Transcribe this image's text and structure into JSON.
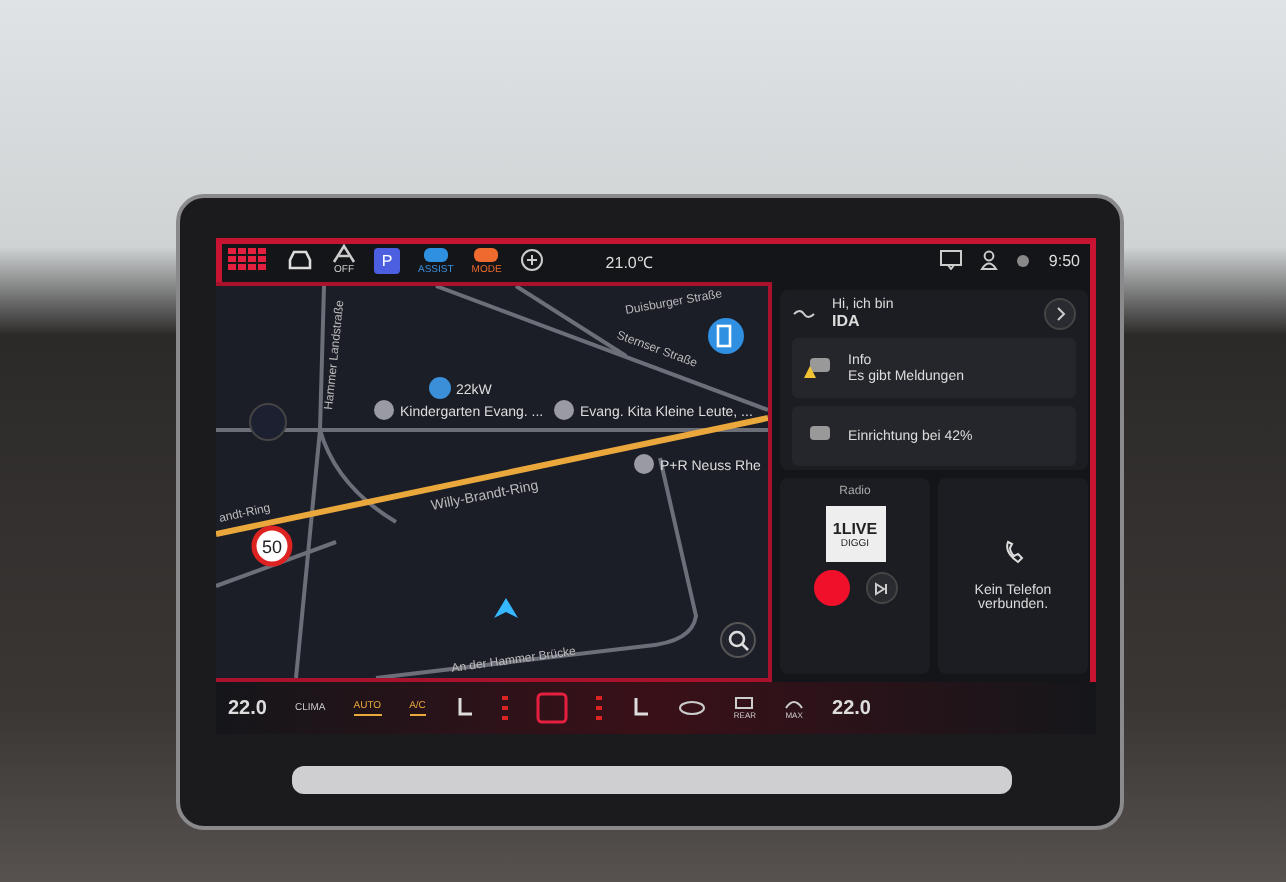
{
  "top_bar": {
    "off_label": "OFF",
    "parking_label": "P",
    "assist_label": "ASSIST",
    "mode_label": "MODE",
    "temperature": "21.0℃",
    "time": "9:50"
  },
  "map": {
    "charger_label": "22kW",
    "speed_limit": "50",
    "places": [
      {
        "label": "Kindergarten Evang. ..."
      },
      {
        "label": "Evang. Kita Kleine Leute, ..."
      },
      {
        "label": "P+R Neuss Rhe"
      }
    ],
    "streets": [
      {
        "name": "Willy-Brandt-Ring"
      },
      {
        "name": "andt-Ring"
      },
      {
        "name": "Hammer Landstraße"
      },
      {
        "name": "An der Hammer Brücke"
      },
      {
        "name": "Duisburger Straße"
      },
      {
        "name": "Sternser Straße"
      }
    ]
  },
  "assistant": {
    "greeting": "Hi, ich bin",
    "name": "IDA",
    "cards": [
      {
        "title": "Info",
        "subtitle": "Es gibt Meldungen",
        "warning": true
      },
      {
        "title": "Einrichtung bei 42%",
        "warning": false
      }
    ]
  },
  "radio": {
    "label": "Radio",
    "station": "1LIVE",
    "station_sub": "DIGGI"
  },
  "phone": {
    "message": "Kein Telefon verbunden."
  },
  "climate": {
    "left_temp": "22.0",
    "mode_label": "CLIMA",
    "auto": {
      "label": "AUTO",
      "selected": true
    },
    "ac": {
      "label": "A/C",
      "selected": true
    },
    "rear_label": "REAR",
    "max_label": "MAX",
    "right_temp": "22.0"
  }
}
